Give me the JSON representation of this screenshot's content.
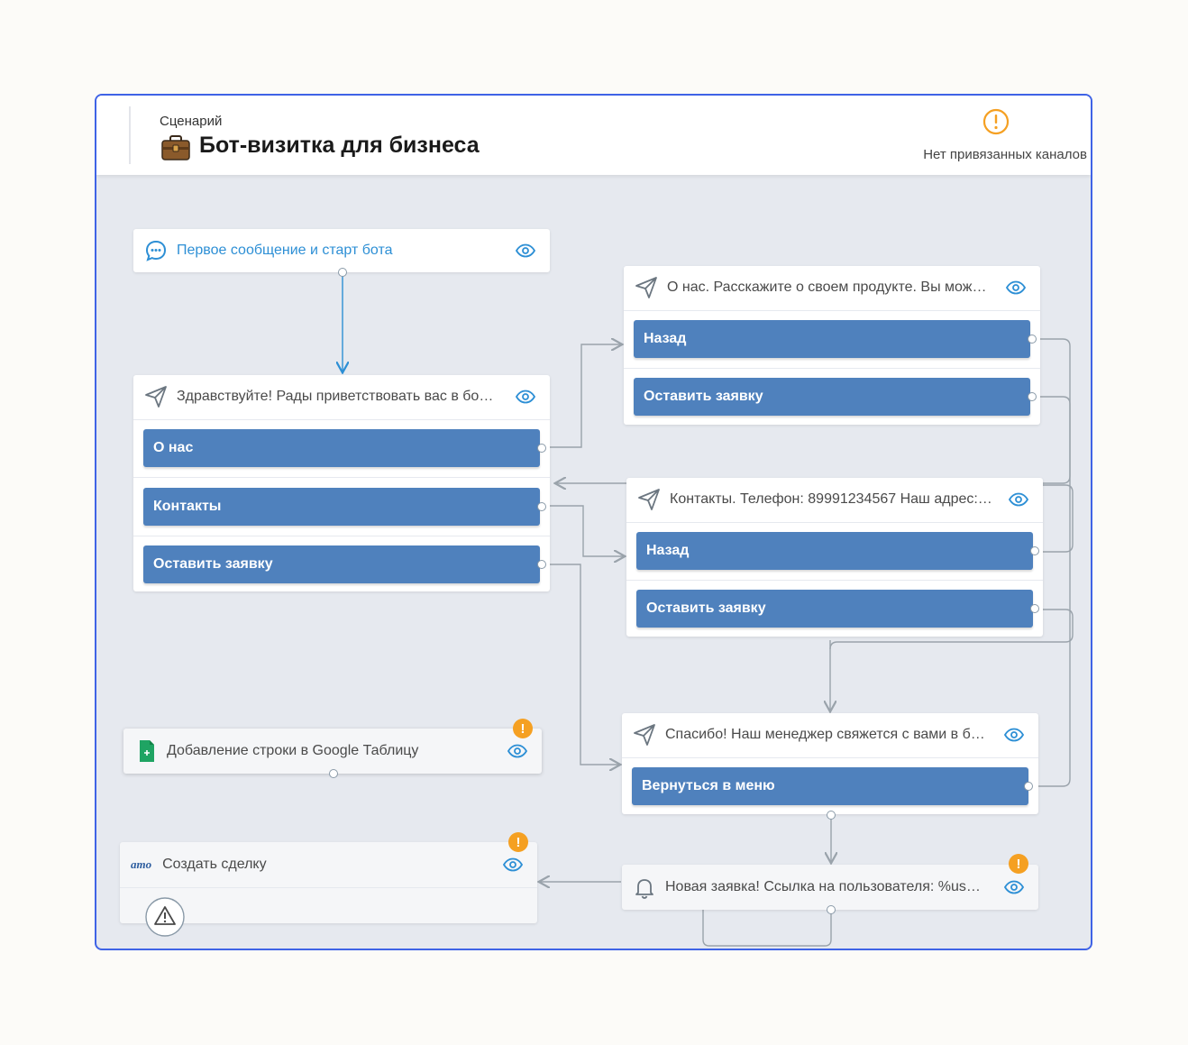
{
  "header": {
    "label": "Сценарий",
    "title": "Бот-визитка для бизнеса",
    "status": "Нет привязанных каналов"
  },
  "colors": {
    "accent": "#3f63e6",
    "button": "#4f81bd",
    "link": "#2d8fd5",
    "warning": "#f5a022"
  },
  "nodes": {
    "start": {
      "text": "Первое сообщение и старт бота",
      "icon": "chat-bubble-icon"
    },
    "greeting": {
      "text": "Здравствуйте! Рады приветствовать вас в бо…",
      "icon": "send-icon",
      "buttons": [
        "О нас",
        "Контакты",
        "Оставить заявку"
      ]
    },
    "about": {
      "text": "О нас. Расскажите о своем продукте. Вы мож…",
      "icon": "send-icon",
      "buttons": [
        "Назад",
        "Оставить заявку"
      ]
    },
    "contacts": {
      "text": "Контакты. Телефон: 89991234567 Наш адрес:…",
      "icon": "send-icon",
      "buttons": [
        "Назад",
        "Оставить заявку"
      ]
    },
    "thanks": {
      "text": "Спасибо! Наш менеджер свяжется с вами в б…",
      "icon": "send-icon",
      "buttons": [
        "Вернуться в меню"
      ]
    },
    "sheets": {
      "text": "Добавление строки в Google Таблицу",
      "icon": "google-sheets-icon",
      "badge": "!"
    },
    "deal": {
      "text": "Создать сделку",
      "icon": "amo-logo-icon",
      "logo": "amo",
      "badge": "!"
    },
    "notify": {
      "text": "Новая заявка! Ссылка на пользователя: %us…",
      "icon": "bell-icon",
      "badge": "!"
    }
  }
}
